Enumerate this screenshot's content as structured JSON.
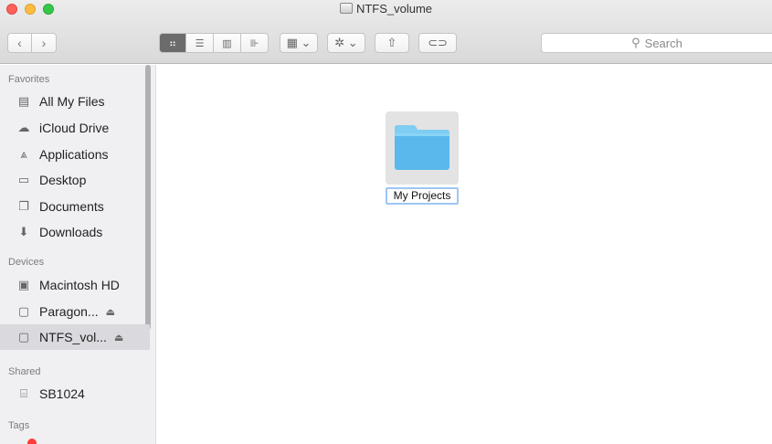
{
  "window": {
    "title": "NTFS_volume",
    "traffic_lights": [
      "close",
      "minimize",
      "zoom"
    ]
  },
  "toolbar": {
    "back_icon": "chevron-left-icon",
    "forward_icon": "chevron-right-icon",
    "back_glyph": "‹",
    "forward_glyph": "›",
    "view_modes": [
      {
        "name": "icon-view",
        "glyph": "⠶",
        "selected": true
      },
      {
        "name": "list-view",
        "glyph": "☰",
        "selected": false
      },
      {
        "name": "column-view",
        "glyph": "▥",
        "selected": false
      },
      {
        "name": "cover-flow-view",
        "glyph": "⊪",
        "selected": false
      }
    ],
    "arrange_glyph": "▦ ⌄",
    "action_glyph": "✲ ⌄",
    "share_glyph": "⇧",
    "tag_glyph": "⊂⊃",
    "search_icon": "magnifier-icon",
    "search_glyph": "⚲",
    "search_placeholder": "Search"
  },
  "sidebar": {
    "sections": [
      {
        "heading": "Favorites",
        "items": [
          {
            "label": "All My Files",
            "icon": "all-files-icon",
            "glyph": "▤"
          },
          {
            "label": "iCloud Drive",
            "icon": "cloud-icon",
            "glyph": "☁"
          },
          {
            "label": "Applications",
            "icon": "applications-icon",
            "glyph": "⩓"
          },
          {
            "label": "Desktop",
            "icon": "desktop-icon",
            "glyph": "▭"
          },
          {
            "label": "Documents",
            "icon": "documents-icon",
            "glyph": "❐"
          },
          {
            "label": "Downloads",
            "icon": "downloads-icon",
            "glyph": "⬇"
          }
        ]
      },
      {
        "heading": "Devices",
        "items": [
          {
            "label": "Macintosh HD",
            "icon": "hard-disk-icon",
            "glyph": "▣"
          },
          {
            "label": "Paragon...",
            "icon": "external-disk-icon",
            "glyph": "▢",
            "eject": "⏏"
          },
          {
            "label": "NTFS_vol...",
            "icon": "external-disk-icon",
            "glyph": "▢",
            "eject": "⏏",
            "selected": true
          }
        ]
      },
      {
        "heading": "Shared",
        "items": [
          {
            "label": "SB1024",
            "icon": "network-server-icon",
            "glyph": "⌸"
          }
        ]
      },
      {
        "heading": "Tags",
        "items": []
      }
    ]
  },
  "content": {
    "items": [
      {
        "name": "My Projects",
        "type": "folder",
        "editing": true
      }
    ]
  },
  "colors": {
    "folder_top": "#7ecdf3",
    "folder_body": "#5ab8ec",
    "selection_border": "#9ec6f5"
  }
}
